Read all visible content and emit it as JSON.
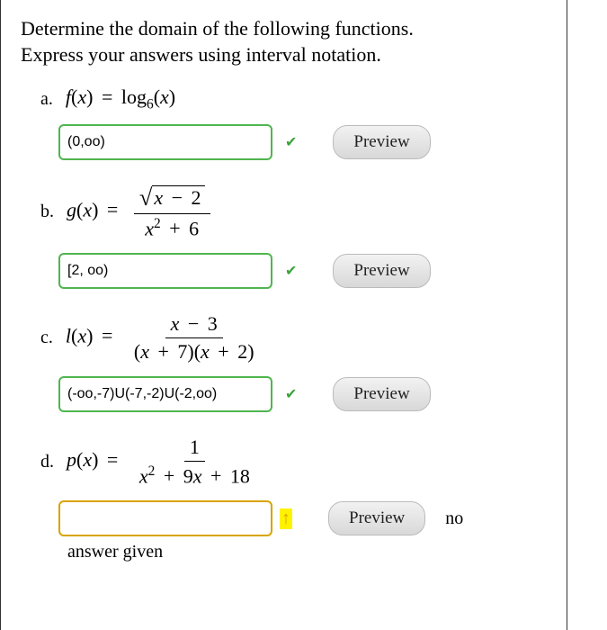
{
  "intro_line1": "Determine the domain of the following functions.",
  "intro_line2": "Express your answers using interval notation.",
  "problems": {
    "a": {
      "label": "a.",
      "fn": "f",
      "eq_plain": "f(x) = log_6(x)",
      "input_value": "(0,oo)",
      "status": "correct",
      "preview_label": "Preview"
    },
    "b": {
      "label": "b.",
      "fn": "g",
      "eq_plain": "g(x) = sqrt(x - 2) / (x^2 + 6)",
      "input_value": "[2, oo)",
      "status": "correct",
      "preview_label": "Preview"
    },
    "c": {
      "label": "c.",
      "fn": "l",
      "eq_plain": "l(x) = (x - 3) / ((x + 7)(x + 2))",
      "input_value": "(-oo,-7)U(-7,-2)U(-2,oo)",
      "status": "correct",
      "preview_label": "Preview"
    },
    "d": {
      "label": "d.",
      "fn": "p",
      "eq_plain": "p(x) = 1 / (x^2 + 9x + 18)",
      "input_value": "",
      "status": "pending",
      "preview_label": "Preview",
      "trailing": "no",
      "below": "answer given"
    }
  }
}
